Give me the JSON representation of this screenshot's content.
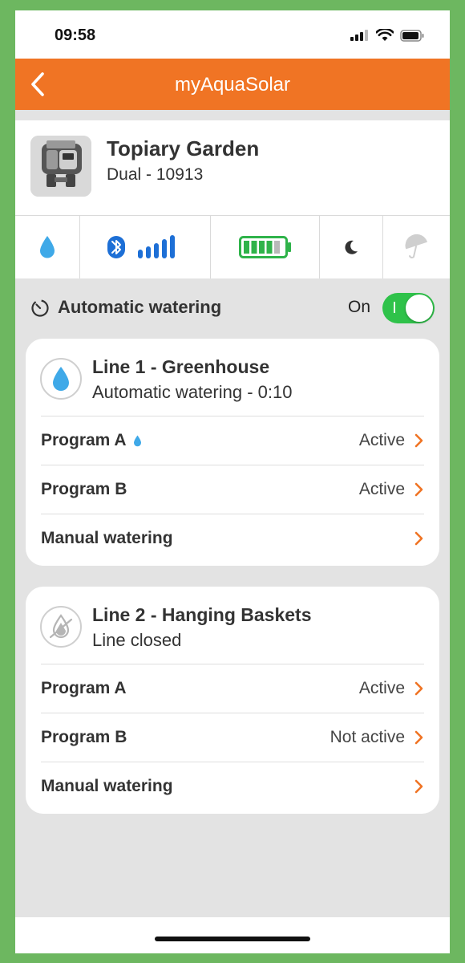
{
  "status_bar": {
    "time": "09:58"
  },
  "nav": {
    "title": "myAquaSolar"
  },
  "device": {
    "name": "Topiary Garden",
    "subtitle": "Dual - 10913"
  },
  "status_strip": [
    "water-drop-icon",
    "bluetooth-signal-icon",
    "battery-icon",
    "night-icon",
    "rain-umbrella-icon"
  ],
  "auto_watering": {
    "label": "Automatic watering",
    "toggle_label": "On",
    "enabled": true
  },
  "colors": {
    "accent": "#f07424",
    "drop": "#3fa9e8",
    "toggle_on": "#2fc24a",
    "signal": "#1d6fd6",
    "battery": "#2fb34a"
  },
  "lines": [
    {
      "title": "Line 1 - Greenhouse",
      "subtitle": "Automatic watering - 0:10",
      "rows": [
        {
          "label": "Program A",
          "value": "Active",
          "drop": true
        },
        {
          "label": "Program B",
          "value": "Active",
          "drop": false
        },
        {
          "label": "Manual watering",
          "value": "",
          "drop": false
        }
      ]
    },
    {
      "title": "Line 2 - Hanging Baskets",
      "subtitle": "Line closed",
      "rows": [
        {
          "label": "Program A",
          "value": "Active",
          "drop": false
        },
        {
          "label": "Program B",
          "value": "Not active",
          "drop": false
        },
        {
          "label": "Manual watering",
          "value": "",
          "drop": false
        }
      ]
    }
  ]
}
